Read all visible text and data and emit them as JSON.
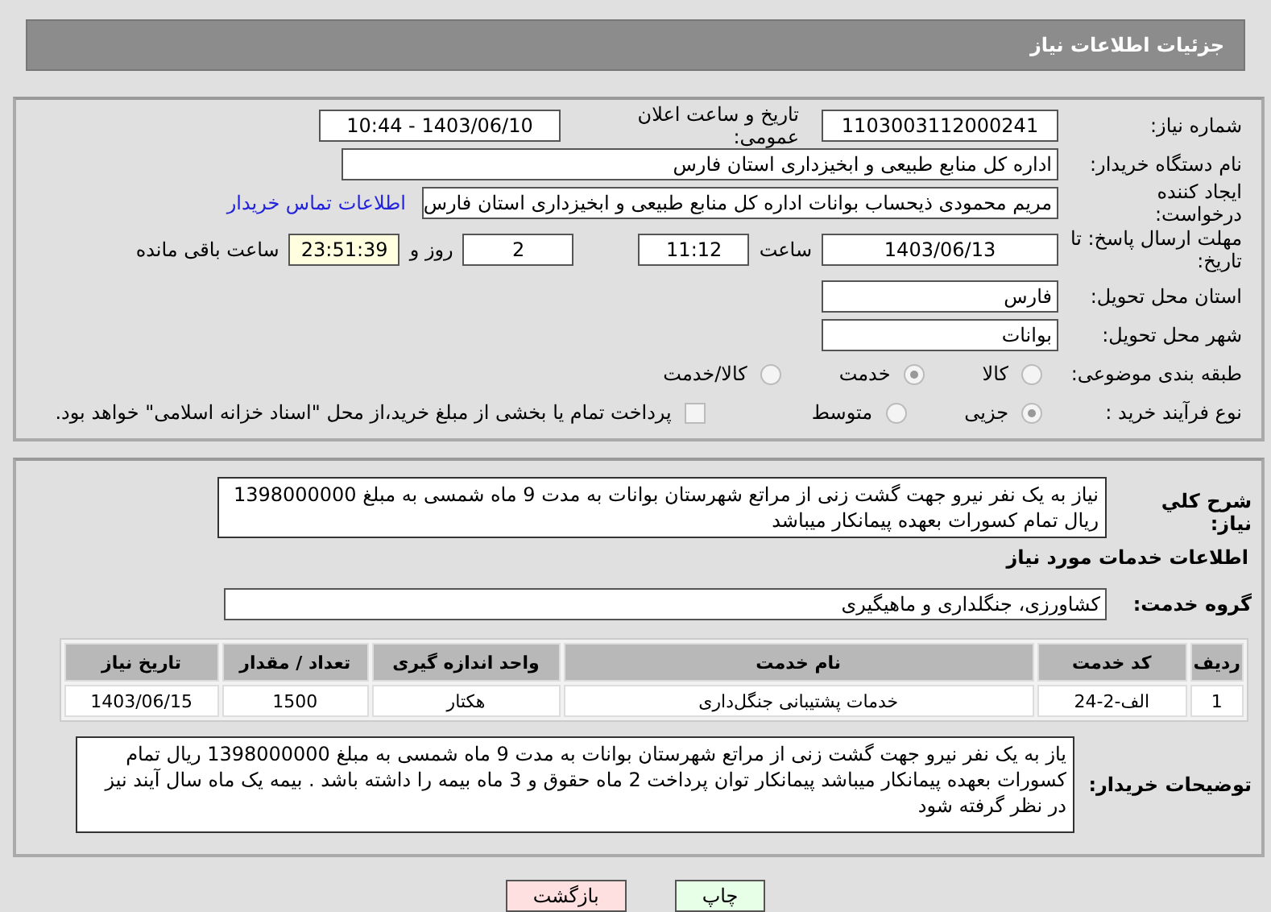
{
  "header": {
    "title": "جزئیات اطلاعات نیاز"
  },
  "need_number": {
    "label": "شماره نیاز:",
    "value": "1103003112000241"
  },
  "announce": {
    "label": "تاریخ و ساعت اعلان عمومی:",
    "value": "1403/06/10 - 10:44"
  },
  "buyer": {
    "label": "نام دستگاه خریدار:",
    "value": "اداره کل منابع طبیعی و ابخیزداری استان فارس"
  },
  "creator": {
    "label": "ایجاد کننده درخواست:",
    "value": "مریم محمودی ذیحساب بوانات اداره کل منابع طبیعی و ابخیزداری استان فارس",
    "link": "اطلاعات تماس خریدار"
  },
  "deadline": {
    "label": "مهلت ارسال پاسخ: تا تاریخ:",
    "date": "1403/06/13",
    "time_label": "ساعت",
    "time": "11:12",
    "days": "2",
    "days_label": "روز و",
    "remaining": "23:51:39",
    "remaining_label": "ساعت باقی مانده"
  },
  "province": {
    "label": "استان محل تحویل:",
    "value": "فارس"
  },
  "city": {
    "label": "شهر محل تحویل:",
    "value": "بوانات"
  },
  "category": {
    "label": "طبقه بندی موضوعی:",
    "options": [
      {
        "label": "کالا",
        "selected": false
      },
      {
        "label": "خدمت",
        "selected": true
      },
      {
        "label": "کالا/خدمت",
        "selected": false
      }
    ]
  },
  "process": {
    "label": "نوع فرآیند خرید :",
    "options": [
      {
        "label": "جزیی",
        "selected": true
      },
      {
        "label": "متوسط",
        "selected": false
      }
    ],
    "payment": {
      "checked": false,
      "label": "پرداخت تمام یا بخشی از مبلغ خرید،از محل \"اسناد خزانه اسلامی\" خواهد بود."
    }
  },
  "summary": {
    "label": "شرح کلي نياز:",
    "value": "نیاز به یک نفر نیرو جهت گشت زنی از مراتع شهرستان بوانات به مدت 9 ماه شمسی به مبلغ 1398000000 ریال تمام کسورات بعهده پیمانکار میباشد"
  },
  "services_heading": "اطلاعات خدمات مورد نیاز",
  "service_group": {
    "label": "گروه خدمت:",
    "value": "کشاورزی، جنگلداری و ماهیگیری"
  },
  "table": {
    "columns": [
      "ردیف",
      "کد خدمت",
      "نام خدمت",
      "واحد اندازه گیری",
      "تعداد / مقدار",
      "تاریخ نیاز"
    ],
    "rows": [
      [
        "1",
        "الف-2-24",
        "خدمات پشتیبانی جنگل‌داری",
        "هکتار",
        "1500",
        "1403/06/15"
      ]
    ]
  },
  "buyer_notes": {
    "label": "توضیحات خریدار:",
    "value": "یاز به یک نفر نیرو جهت گشت زنی از مراتع شهرستان بوانات به مدت 9 ماه شمسی به مبلغ 1398000000 ریال تمام کسورات بعهده پیمانکار میباشد پیمانکار توان پرداخت 2 ماه حقوق و 3 ماه بیمه را داشته باشد . بیمه یک ماه سال آیند نیز در نظر گرفته شود"
  },
  "buttons": [
    {
      "label": "چاپ",
      "kind": "print"
    },
    {
      "label": "بازگشت",
      "kind": "back"
    }
  ]
}
